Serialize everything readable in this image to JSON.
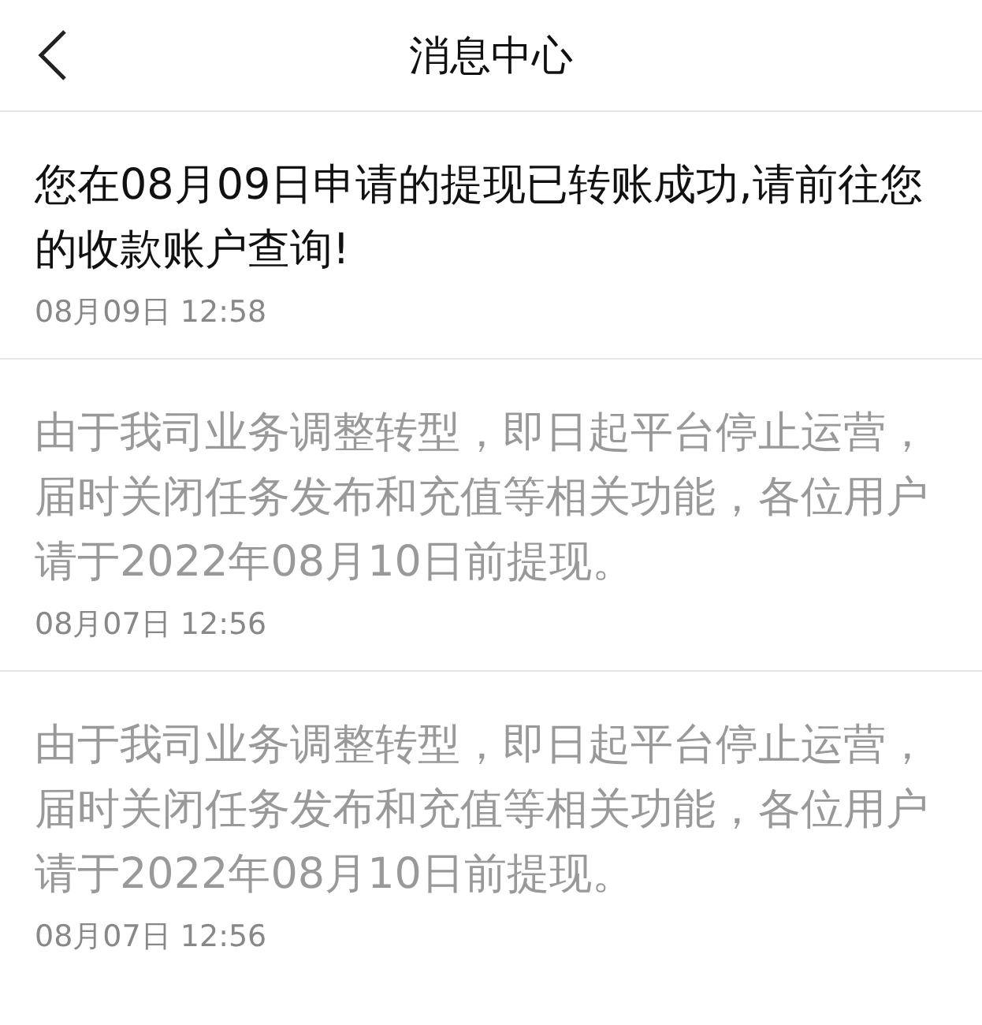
{
  "header": {
    "title": "消息中心"
  },
  "messages": [
    {
      "text": "您在08月09日申请的提现已转账成功,请前往您的收款账户查询!",
      "time": "08月09日 12:58",
      "read": false
    },
    {
      "text": "由于我司业务调整转型，即日起平台停止运营，届时关闭任务发布和充值等相关功能，各位用户请于2022年08月10日前提现。",
      "time": "08月07日 12:56",
      "read": true
    },
    {
      "text": "由于我司业务调整转型，即日起平台停止运营，届时关闭任务发布和充值等相关功能，各位用户请于2022年08月10日前提现。",
      "time": "08月07日 12:56",
      "read": true
    }
  ]
}
